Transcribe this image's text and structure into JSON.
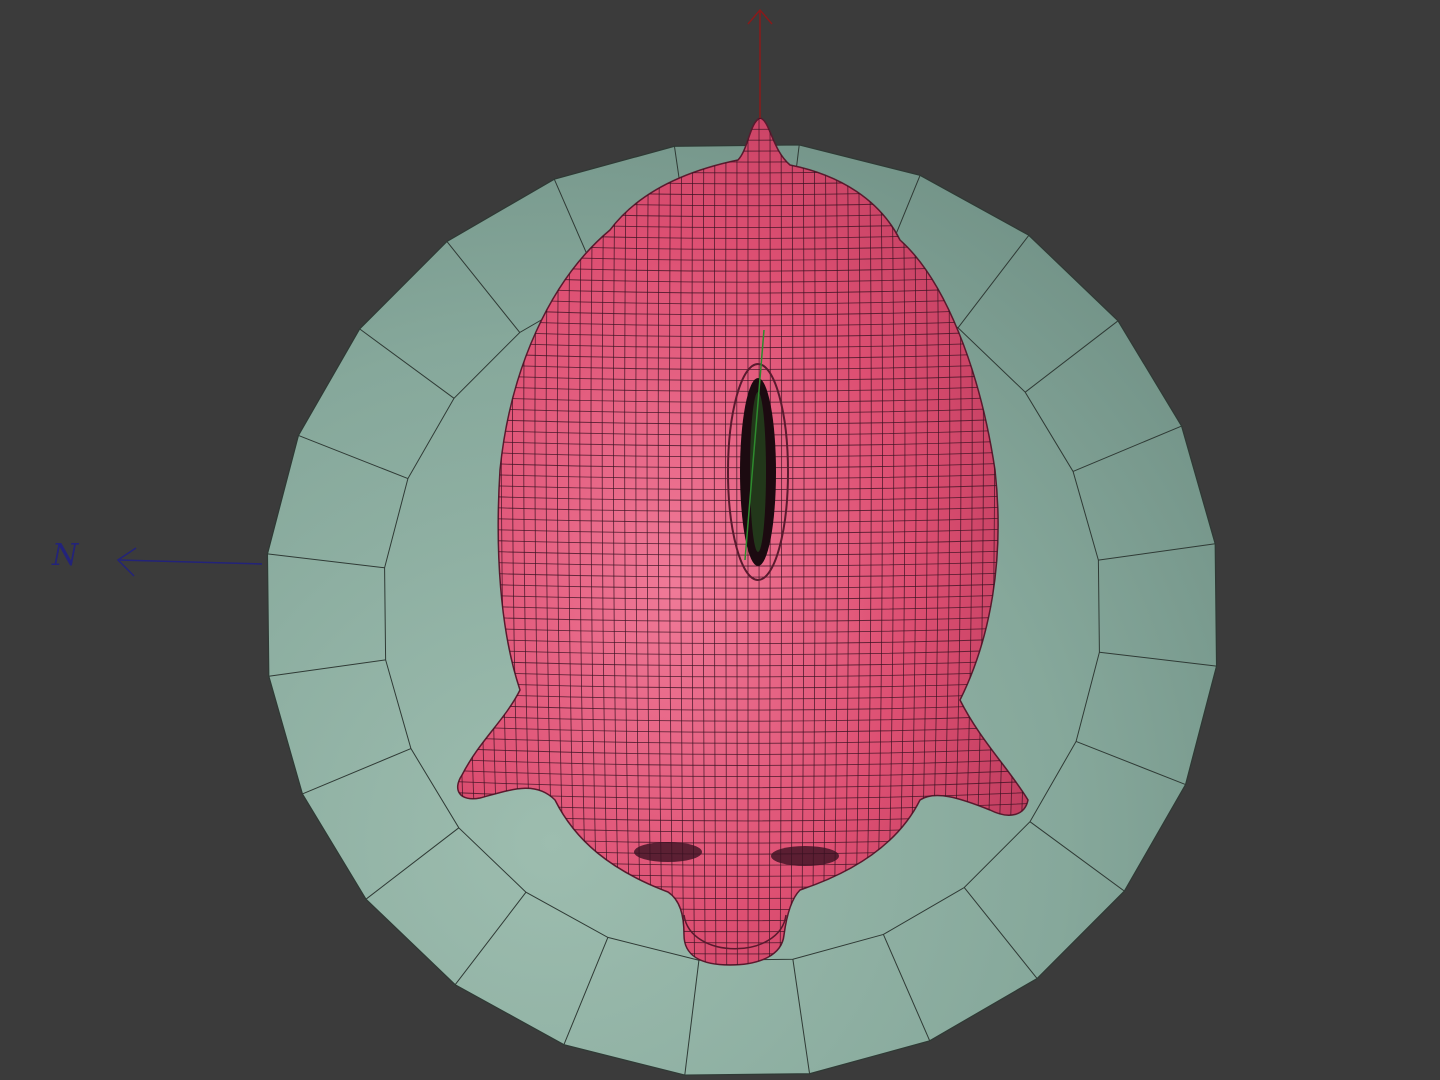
{
  "viewport": {
    "background": "#3b3b3b",
    "view": "top"
  },
  "gizmo": {
    "z_axis_color": "#8a1a1a",
    "x_axis_color": "#23237a",
    "y_axis_color": "#2e8b2e",
    "x_axis_label": "N"
  },
  "pedestal": {
    "fill": "#86a89b",
    "wire_color": "#2f3a35",
    "segments": 24
  },
  "mesh": {
    "name": "piggy-bank",
    "fill": "#e05878",
    "wire_color": "#3a1222",
    "features": [
      "coin-slot",
      "ears",
      "eyes",
      "snout",
      "tail"
    ]
  }
}
